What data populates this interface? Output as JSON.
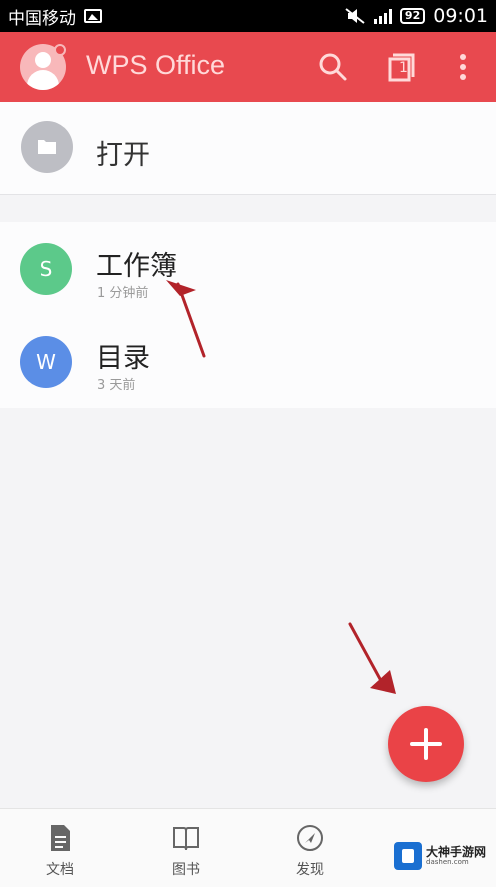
{
  "status_bar": {
    "carrier": "中国移动",
    "battery": "92",
    "time": "09:01"
  },
  "app_bar": {
    "title": "WPS Office",
    "tabs_count": "1",
    "accent": "#e8494f"
  },
  "open": {
    "label": "打开"
  },
  "recent_files": [
    {
      "name": "工作簿",
      "time": "1 分钟前",
      "badge": "S",
      "color": "#5cc98a"
    },
    {
      "name": "目录",
      "time": "3 天前",
      "badge": "W",
      "color": "#5b8ee6"
    }
  ],
  "fab": {
    "icon": "plus-icon",
    "color": "#ea4347"
  },
  "bottom_nav": [
    {
      "label": "文档",
      "icon": "document-icon"
    },
    {
      "label": "图书",
      "icon": "book-icon"
    },
    {
      "label": "发现",
      "icon": "compass-icon"
    }
  ],
  "watermark": {
    "text": "大神手游网",
    "sub": "dashen.com"
  }
}
